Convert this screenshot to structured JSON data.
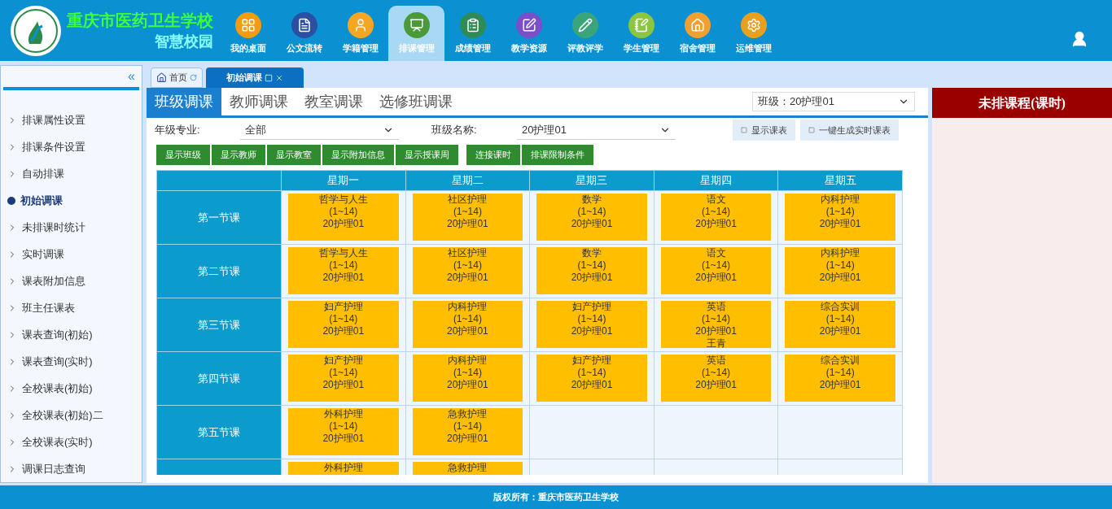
{
  "header": {
    "school": "重庆市医药卫生学校",
    "subtitle": "智慧校园"
  },
  "nav": [
    {
      "label": "我的桌面",
      "selected": false,
      "color": "#f39c12"
    },
    {
      "label": "公文流转",
      "selected": false,
      "color": "#2b4fa3"
    },
    {
      "label": "学籍管理",
      "selected": false,
      "color": "#f5a623"
    },
    {
      "label": "排课管理",
      "selected": true,
      "color": "#4a9a3a"
    },
    {
      "label": "成绩管理",
      "selected": false,
      "color": "#2e8b57"
    },
    {
      "label": "教学资源",
      "selected": false,
      "color": "#7b4fc9"
    },
    {
      "label": "评教评学",
      "selected": false,
      "color": "#3aa57a"
    },
    {
      "label": "学生管理",
      "selected": false,
      "color": "#8cc63f"
    },
    {
      "label": "宿舍管理",
      "selected": false,
      "color": "#f0a030"
    },
    {
      "label": "运维管理",
      "selected": false,
      "color": "#e8a020"
    }
  ],
  "sidebar": {
    "collapse": "«",
    "items": [
      {
        "label": "排课属性设置",
        "selected": false
      },
      {
        "label": "排课条件设置",
        "selected": false
      },
      {
        "label": "自动排课",
        "selected": false
      },
      {
        "label": "初始调课",
        "selected": true
      },
      {
        "label": "未排课时统计",
        "selected": false
      },
      {
        "label": "实时调课",
        "selected": false
      },
      {
        "label": "课表附加信息",
        "selected": false
      },
      {
        "label": "班主任课表",
        "selected": false
      },
      {
        "label": "课表查询(初始)",
        "selected": false
      },
      {
        "label": "课表查询(实时)",
        "selected": false
      },
      {
        "label": "全校课表(初始)",
        "selected": false
      },
      {
        "label": "全校课表(初始)二",
        "selected": false
      },
      {
        "label": "全校课表(实时)",
        "selected": false
      },
      {
        "label": "调课日志查询",
        "selected": false
      }
    ]
  },
  "page_tabs": [
    {
      "label": "首页",
      "selected": false,
      "kind": "home"
    },
    {
      "label": "初始调课",
      "selected": true,
      "kind": "closable"
    }
  ],
  "mode_tabs": [
    {
      "label": "班级调课",
      "selected": true
    },
    {
      "label": "教师调课",
      "selected": false
    },
    {
      "label": "教室调课",
      "selected": false
    },
    {
      "label": "选修班调课",
      "selected": false
    }
  ],
  "class_select": {
    "value": "班级：20护理01"
  },
  "filters": [
    {
      "label": "年级专业:",
      "value": "全部"
    },
    {
      "label": "班级名称:",
      "value": "20护理01"
    }
  ],
  "action_buttons": [
    "显示课表",
    "一键生成实时课表"
  ],
  "button_groups": [
    [
      "显示班级",
      "显示教师",
      "显示教室",
      "显示附加信息",
      "显示授课周"
    ],
    [
      "连接课时",
      "排课限制条件"
    ]
  ],
  "timetable": {
    "columns": [
      "星期一",
      "星期二",
      "星期三",
      "星期四",
      "星期五"
    ],
    "rows": [
      {
        "period": "第一节课",
        "cells": [
          {
            "kind": "course",
            "subject": "哲学与人生",
            "weeks": "(1~14)",
            "class": "20护理01"
          },
          {
            "kind": "course",
            "subject": "社区护理",
            "weeks": "(1~14)",
            "class": "20护理01"
          },
          {
            "kind": "course",
            "subject": "数学",
            "weeks": "(1~14)",
            "class": "20护理01"
          },
          {
            "kind": "course",
            "subject": "语文",
            "weeks": "(1~14)",
            "class": "20护理01"
          },
          {
            "kind": "course",
            "subject": "内科护理",
            "weeks": "(1~14)",
            "class": "20护理01"
          }
        ]
      },
      {
        "period": "第二节课",
        "cells": [
          {
            "kind": "course",
            "subject": "哲学与人生",
            "weeks": "(1~14)",
            "class": "20护理01"
          },
          {
            "kind": "course",
            "subject": "社区护理",
            "weeks": "(1~14)",
            "class": "20护理01"
          },
          {
            "kind": "course",
            "subject": "数学",
            "weeks": "(1~14)",
            "class": "20护理01"
          },
          {
            "kind": "course",
            "subject": "语文",
            "weeks": "(1~14)",
            "class": "20护理01"
          },
          {
            "kind": "course",
            "subject": "内科护理",
            "weeks": "(1~14)",
            "class": "20护理01"
          }
        ]
      },
      {
        "period": "第三节课",
        "cells": [
          {
            "kind": "course",
            "subject": "妇产护理",
            "weeks": "(1~14)",
            "class": "20护理01"
          },
          {
            "kind": "course",
            "subject": "内科护理",
            "weeks": "(1~14)",
            "class": "20护理01"
          },
          {
            "kind": "course",
            "subject": "妇产护理",
            "weeks": "(1~14)",
            "class": "20护理01"
          },
          {
            "kind": "course",
            "subject": "英语",
            "weeks": "(1~14)",
            "class": "20护理01",
            "teacher": "王青"
          },
          {
            "kind": "course",
            "subject": "综合实训",
            "weeks": "(1~14)",
            "class": "20护理01"
          }
        ]
      },
      {
        "period": "第四节课",
        "cells": [
          {
            "kind": "course",
            "subject": "妇产护理",
            "weeks": "(1~14)",
            "class": "20护理01"
          },
          {
            "kind": "course",
            "subject": "内科护理",
            "weeks": "(1~14)",
            "class": "20护理01"
          },
          {
            "kind": "course",
            "subject": "妇产护理",
            "weeks": "(1~14)",
            "class": "20护理01"
          },
          {
            "kind": "course",
            "subject": "英语",
            "weeks": "(1~14)",
            "class": "20护理01"
          },
          {
            "kind": "course",
            "subject": "综合实训",
            "weeks": "(1~14)",
            "class": "20护理01"
          }
        ]
      },
      {
        "period": "第五节课",
        "cells": [
          {
            "kind": "course",
            "subject": "外科护理",
            "weeks": "(1~14)",
            "class": "20护理01"
          },
          {
            "kind": "course",
            "subject": "急救护理",
            "weeks": "(1~14)",
            "class": "20护理01"
          },
          {
            "kind": "empty"
          },
          {
            "kind": "empty"
          },
          {
            "kind": "empty"
          }
        ]
      },
      {
        "cells": [
          {
            "kind": "course",
            "subject": "外科护理"
          },
          {
            "kind": "course",
            "subject": "急救护理"
          },
          {
            "kind": "empty"
          },
          {
            "kind": "empty"
          },
          {
            "kind": "empty"
          }
        ]
      }
    ]
  },
  "side_panel": {
    "title": "未排课程(课时)"
  },
  "footer": "版权所有：重庆市医药卫生学校"
}
